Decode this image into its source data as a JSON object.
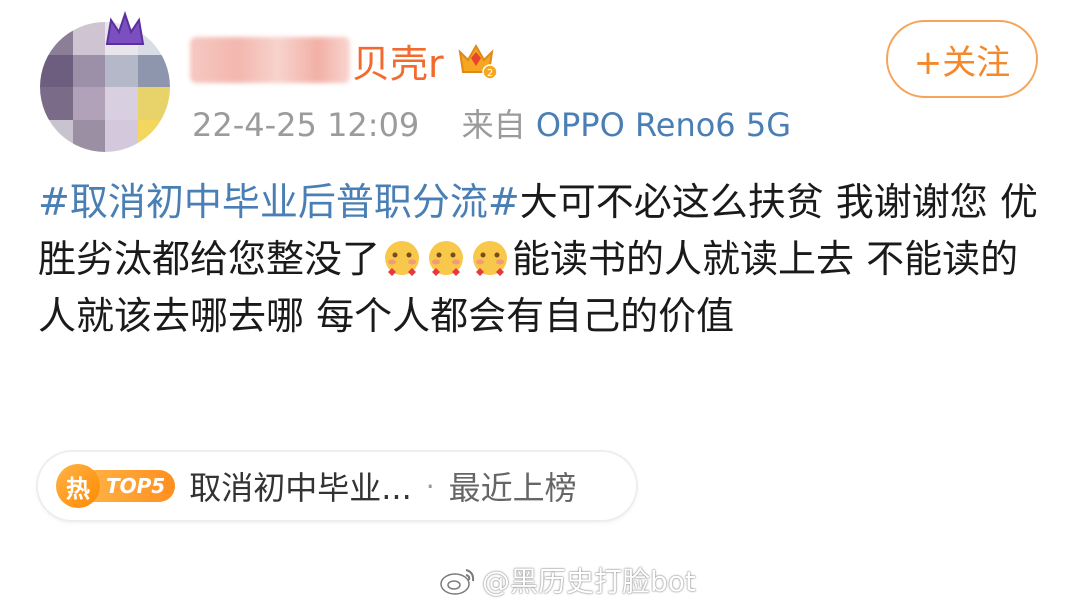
{
  "author": {
    "name_visible": "贝壳r",
    "timestamp": "22-4-25 12:09",
    "via_label": "来自",
    "device": "OPPO Reno6 5G"
  },
  "follow_button": {
    "label": "+关注"
  },
  "post": {
    "hashtag": "#取消初中毕业后普职分流#",
    "text_part1": "大可不必这么扶贫 我谢谢您 优胜劣汰都给您整没了",
    "emojis": [
      "shy-emoji",
      "shy-emoji",
      "shy-emoji"
    ],
    "text_part2": "能读书的人就读上去 不能读的人就该去哪去哪 每个人都会有自己的价值"
  },
  "hot_topic": {
    "badge_char": "热",
    "rank": "TOP5",
    "title": "取消初中毕业...",
    "separator": "·",
    "status": "最近上榜"
  },
  "watermark": {
    "text": "@黑历史打脸bot"
  },
  "colors": {
    "link_blue": "#4a7fb5",
    "accent_orange": "#f4892c",
    "meta_gray": "#9b9b9b"
  }
}
